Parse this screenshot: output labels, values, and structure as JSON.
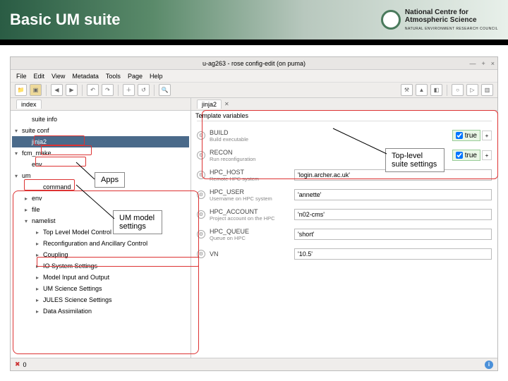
{
  "slide": {
    "title": "Basic UM suite",
    "logo": {
      "line1": "National Centre for",
      "line2": "Atmospheric Science",
      "line3": "NATURAL ENVIRONMENT RESEARCH COUNCIL"
    }
  },
  "window": {
    "title": "u-ag263 - rose config-edit (on puma)",
    "menus": [
      "File",
      "Edit",
      "View",
      "Metadata",
      "Tools",
      "Page",
      "Help"
    ]
  },
  "left": {
    "index_label": "index",
    "suite_info": "suite info",
    "suite_conf": "suite conf",
    "jinja2": "jinja2",
    "fcm_make": "fcm_make",
    "env": "env",
    "um": "um",
    "command": "command",
    "env2": "env",
    "file": "file",
    "namelist": "namelist",
    "sections": [
      "Top Level Model Control",
      "Reconfiguration and Ancillary Control",
      "Coupling",
      "IO System Settings",
      "Model Input and Output",
      "UM Science Settings",
      "JULES Science Settings",
      "Data Assimilation"
    ]
  },
  "right": {
    "tab": "jinja2",
    "section": "Template variables",
    "rows": [
      {
        "n": "BUILD",
        "d": "Build executable",
        "t": "chk",
        "v": "true"
      },
      {
        "n": "RECON",
        "d": "Run reconfiguration",
        "t": "chk",
        "v": "true"
      },
      {
        "n": "HPC_HOST",
        "d": "Remote HPC system",
        "t": "txt",
        "v": "'login.archer.ac.uk'"
      },
      {
        "n": "HPC_USER",
        "d": "Username on HPC system",
        "t": "txt",
        "v": "'annette'"
      },
      {
        "n": "HPC_ACCOUNT",
        "d": "Project account on the HPC",
        "t": "txt",
        "v": "'n02-cms'"
      },
      {
        "n": "HPC_QUEUE",
        "d": "Queue on HPC",
        "t": "txt",
        "v": "'short'"
      },
      {
        "n": "VN",
        "d": "",
        "t": "txt",
        "v": "'10.5'"
      }
    ]
  },
  "status": {
    "count": "0"
  },
  "callouts": {
    "apps": "Apps",
    "um": "UM model settings",
    "top": "Top-level suite settings"
  }
}
